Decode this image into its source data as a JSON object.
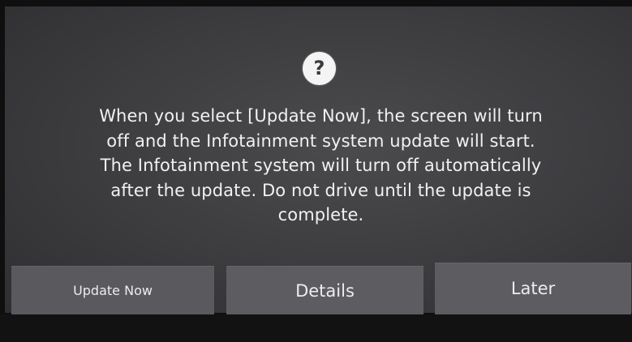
{
  "dialog": {
    "icon": "question-icon",
    "icon_glyph": "?",
    "message_lines": [
      "When you select [Update Now], the screen will turn",
      "off and the Infotainment system update will start.",
      "The Infotainment system will turn off automatically",
      "after the update. Do not drive until the update is",
      "complete."
    ]
  },
  "buttons": {
    "update_now": "Update Now",
    "details": "Details",
    "later": "Later"
  }
}
